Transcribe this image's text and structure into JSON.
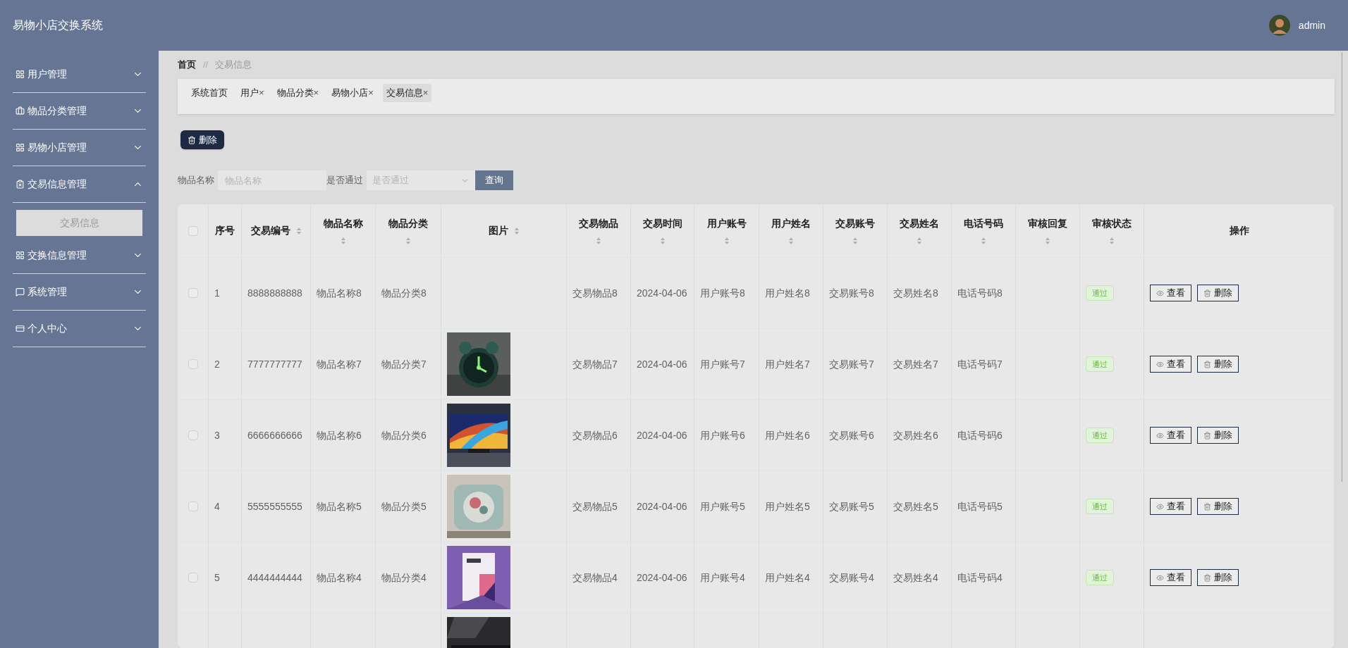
{
  "header": {
    "title": "易物小店交换系统",
    "user": "admin"
  },
  "sidebar": [
    {
      "label": "用户管理",
      "expanded": false
    },
    {
      "label": "物品分类管理",
      "expanded": false
    },
    {
      "label": "易物小店管理",
      "expanded": false
    },
    {
      "label": "交易信息管理",
      "expanded": true,
      "children": [
        {
          "label": "交易信息",
          "selected": true
        }
      ]
    },
    {
      "label": "交换信息管理",
      "expanded": false
    },
    {
      "label": "系统管理",
      "expanded": false
    },
    {
      "label": "个人中心",
      "expanded": false
    }
  ],
  "breadcrumb": {
    "home": "首页",
    "separator": "//",
    "current": "交易信息"
  },
  "tabs": [
    {
      "label": "系统首页",
      "selected": false
    },
    {
      "label": "用户",
      "close": "×",
      "selected": false
    },
    {
      "label": "物品分类",
      "close": "×",
      "selected": false
    },
    {
      "label": "易物小店",
      "close": "×",
      "selected": false
    },
    {
      "label": "交易信息",
      "close": "×",
      "selected": true
    }
  ],
  "toolbar": {
    "delete_button": "删除"
  },
  "search": {
    "fields": [
      {
        "label": "物品名称",
        "kind": "text",
        "placeholder": "物品名称"
      },
      {
        "label": "是否通过",
        "kind": "select",
        "placeholder": "是否通过"
      }
    ],
    "button": "查询"
  },
  "table": {
    "select_all_checked": false,
    "columns": [
      {
        "kind": "check"
      },
      {
        "kind": "text",
        "label": "序号",
        "sortable": false
      },
      {
        "kind": "text",
        "label": "交易编号",
        "sortable": true
      },
      {
        "kind": "text",
        "label": "物品名称",
        "sortable": true
      },
      {
        "kind": "text",
        "label": "物品分类",
        "sortable": true
      },
      {
        "label": "图片",
        "sortable": true
      },
      {
        "kind": "text",
        "label": "交易物品",
        "sortable": true
      },
      {
        "kind": "text",
        "label": "交易时间",
        "sortable": true
      },
      {
        "kind": "text",
        "label": "用户账号",
        "sortable": true
      },
      {
        "kind": "text",
        "label": "用户姓名",
        "sortable": true
      },
      {
        "kind": "text",
        "label": "交易账号",
        "sortable": true
      },
      {
        "kind": "text",
        "label": "交易姓名",
        "sortable": true
      },
      {
        "kind": "text",
        "label": "电话号码",
        "sortable": true
      },
      {
        "kind": "blank",
        "label": "审核回复",
        "sortable": true
      },
      {
        "kind": "status",
        "label": "审核状态",
        "sortable": true
      },
      {
        "kind": "actions",
        "label": "操作",
        "sortable": false
      }
    ],
    "rows": [
      {
        "checked": false,
        "values": [
          "1",
          "8888888888",
          "物品名称8",
          "物品分类8",
          "交易物品8",
          "2024-04-06",
          "用户账号8",
          "用户姓名8",
          "交易账号8",
          "交易姓名8",
          "电话号码8"
        ],
        "status": "通过",
        "actions": [
          "查看",
          "删除"
        ]
      },
      {
        "checked": false,
        "image": {
          "kind": "picture"
        },
        "values": [
          "2",
          "7777777777",
          "物品名称7",
          "物品分类7",
          "交易物品7",
          "2024-04-06",
          "用户账号7",
          "用户姓名7",
          "交易账号7",
          "交易姓名7",
          "电话号码7"
        ],
        "status": "通过",
        "actions": [
          "查看",
          "删除"
        ]
      },
      {
        "checked": false,
        "image": {
          "kind": "picture"
        },
        "values": [
          "3",
          "6666666666",
          "物品名称6",
          "物品分类6",
          "交易物品6",
          "2024-04-06",
          "用户账号6",
          "用户姓名6",
          "交易账号6",
          "交易姓名6",
          "电话号码6"
        ],
        "status": "通过",
        "actions": [
          "查看",
          "删除"
        ]
      },
      {
        "checked": false,
        "image": {
          "kind": "picture"
        },
        "values": [
          "4",
          "5555555555",
          "物品名称5",
          "物品分类5",
          "交易物品5",
          "2024-04-06",
          "用户账号5",
          "用户姓名5",
          "交易账号5",
          "交易姓名5",
          "电话号码5"
        ],
        "status": "通过",
        "actions": [
          "查看",
          "删除"
        ]
      },
      {
        "checked": false,
        "image": {
          "kind": "picture"
        },
        "values": [
          "5",
          "4444444444",
          "物品名称4",
          "物品分类4",
          "交易物品4",
          "2024-04-06",
          "用户账号4",
          "用户姓名4",
          "交易账号4",
          "交易姓名4",
          "电话号码4"
        ],
        "status": "通过",
        "actions": [
          "查看",
          "删除"
        ]
      },
      {
        "image": {
          "kind": "picture"
        }
      }
    ]
  }
}
